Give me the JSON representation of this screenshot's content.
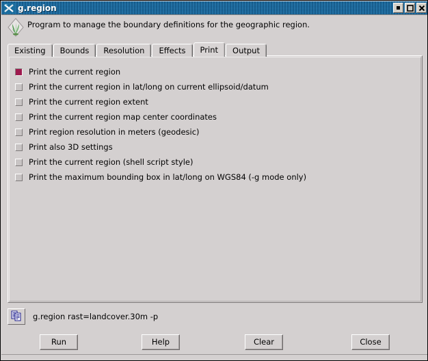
{
  "window": {
    "title": "g.region",
    "title_icon": "x-terminal-icon",
    "controls": [
      {
        "name": "minimize-button",
        "glyph": "▪"
      },
      {
        "name": "maximize-button",
        "glyph": "❐"
      },
      {
        "name": "close-button",
        "glyph": "✖"
      }
    ]
  },
  "header": {
    "icon": "grass-gis-leaf-icon",
    "description": "Program to manage the boundary definitions for the geographic region."
  },
  "tabs": [
    {
      "label": "Existing",
      "active": false
    },
    {
      "label": "Bounds",
      "active": false
    },
    {
      "label": "Resolution",
      "active": false
    },
    {
      "label": "Effects",
      "active": false
    },
    {
      "label": "Print",
      "active": true
    },
    {
      "label": "Output",
      "active": false
    }
  ],
  "print_options": [
    {
      "label": "Print the current region",
      "checked": true
    },
    {
      "label": "Print the current region in lat/long on current ellipsoid/datum",
      "checked": false
    },
    {
      "label": "Print the current region extent",
      "checked": false
    },
    {
      "label": "Print the current region map center coordinates",
      "checked": false
    },
    {
      "label": "Print region resolution in meters (geodesic)",
      "checked": false
    },
    {
      "label": "Print also 3D settings",
      "checked": false
    },
    {
      "label": "Print the current region (shell script style)",
      "checked": false
    },
    {
      "label": "Print the maximum bounding box in lat/long on WGS84 (-g mode only)",
      "checked": false
    }
  ],
  "command_bar": {
    "copy_icon": "copy-documents-icon",
    "command": "g.region rast=landcover.30m -p"
  },
  "buttons": [
    {
      "label": "Run",
      "name": "run-button"
    },
    {
      "label": "Help",
      "name": "help-button"
    },
    {
      "label": "Clear",
      "name": "clear-button"
    },
    {
      "label": "Close",
      "name": "close-dialog-button"
    }
  ],
  "colors": {
    "titlebar": "#11608f",
    "face": "#d4d0d0",
    "checked_box": "#9e1a4e",
    "text": "#000000"
  }
}
